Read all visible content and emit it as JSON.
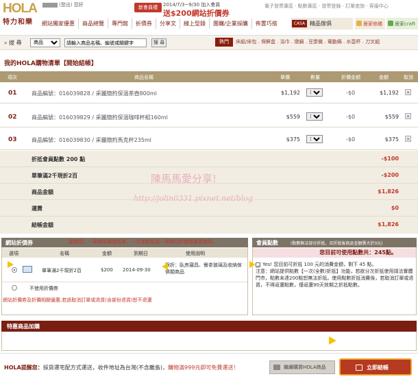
{
  "header": {
    "logo_text": "HOLA",
    "logo_sub": "特力和樂",
    "user_text": "(登出) 您好",
    "promo_tag": "新會員禮",
    "promo_line1": "2014/7/3~9/30 加入會員",
    "promo_line2": "送$200網站折價券",
    "top_links": "電子發票專區 · 點數專區 · 發票登錄 · 訂單查詢 · 客服中心",
    "nav": [
      "網站獨家優惠",
      "商品總覽",
      "專門館",
      "折價券",
      "分享文",
      "線上型錄",
      "團購/企業採購",
      "佈置巧搭"
    ],
    "casa_logo": "CASA",
    "casa_text": "精品傢俱",
    "home1": "居家修繕",
    "home2": "居家craft"
  },
  "search": {
    "label": "搜 尋",
    "category": "商品",
    "placeholder": "請輸入商品名稱、編號或關鍵字",
    "button": "搜 尋",
    "hot_label": "熱門",
    "hot_items": "床組/床包 . 保鮮盒 . 浴巾 . 燉鍋 . 豆漿機 . 電動鍋 . 水壺杯 . 刀叉組"
  },
  "cart": {
    "title": "我的HOLA購物清單【開始結帳】",
    "headers": [
      "項次",
      "商品名稱",
      "單價",
      "數量",
      "折價金額",
      "金額",
      "取消"
    ],
    "rows": [
      {
        "idx": "01",
        "name": "商品編號：016039828  /  采麗簡約保溫茶壺800ml",
        "price": "$1,192",
        "qty": "1",
        "disc": "-$0",
        "amount": "$1,192"
      },
      {
        "idx": "02",
        "name": "商品編號：016039829  /  采麗簡約保溫咖啡杯組160ml",
        "price": "$559",
        "qty": "1",
        "disc": "-$0",
        "amount": "$559"
      },
      {
        "idx": "03",
        "name": "商品編號：016039830  /  采麗簡約馬克杯235ml",
        "price": "$375",
        "qty": "1",
        "disc": "-$0",
        "amount": "$375"
      }
    ],
    "summary": [
      {
        "label": "折抵會員點數 200 點",
        "value": "-$100"
      },
      {
        "label": "單筆滿2千現折2百",
        "value": "-$200"
      },
      {
        "label": "商品金額",
        "value": "$1,826"
      },
      {
        "label": "運費",
        "value": "$0"
      },
      {
        "label": "結帳金額",
        "value": "$1,826"
      }
    ]
  },
  "watermark": {
    "line1": "陳馬馬愛分享!",
    "line2": "http://jolin0331.pixnet.net/blog"
  },
  "coupon": {
    "title": "網站折價券",
    "warning": "提醒您！一筆網站購物清單，一次僅能勾選一張網站折價券優惠使用。",
    "headers": [
      "選項",
      "名稱",
      "金額",
      "到期日",
      "使用說明"
    ],
    "item": {
      "name": "單筆滿2千現折2百",
      "amount": "$200",
      "expiry": "2014-09-30",
      "desc": "限折：臥房寢具、餐茶玻璃及收納傢俱類商品"
    },
    "none_label": "不使用折價券",
    "footer": "網站折價券及折價相關優惠,若過取消訂單或退貨(含部份退貨)恕不退還"
  },
  "points": {
    "title": "會員點數",
    "note": "(點數無法部分折抵，且折抵後商品金額需大於0元)",
    "available": "您目前可使用點數共：245點。",
    "confirm": "Yes! 您目前可折抵 100 元的消費金額，剩下 45 點。",
    "notice": "注意：網站提供點數【一次(全數)折抵】功能，若欲分次折抵使用請洽實體門市，點數未達200點恕無法折抵。使用點數折抵消費後，若取消訂單或退貨，不得返還點數，僅返還90天效期之折抵點數。"
  },
  "special": {
    "title": "特惠商品加購"
  },
  "bottom": {
    "msg_key": "HOLA提醒您：",
    "msg": "採貨運宅配方式運送，收件地址為台灣(不含離島)，",
    "msg_red": "購物滿999元即可免費運送！",
    "continue_btn": "繼續購買HOLA商品",
    "checkout_btn": "立即結帳"
  },
  "colors": {
    "brand": "#7a1e12",
    "accent": "#c0392b",
    "table_header": "#ad9a73"
  }
}
